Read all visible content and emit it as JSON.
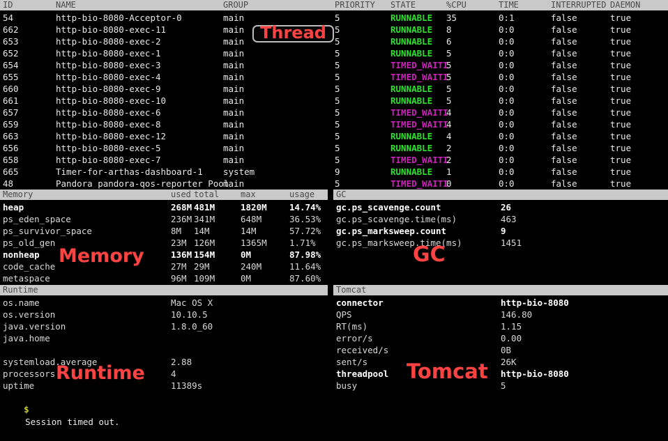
{
  "colors": {
    "background": "#000000",
    "header_bar": "#c9c9c9",
    "header_text": "#4a4a4a",
    "text": "#e8e8e8",
    "state_runnable": "#2ee22e",
    "state_timed_waiting": "#cc22bb",
    "annotation_red": "#fc4343",
    "prompt": "#c8d02a"
  },
  "thread": {
    "annotation": "Thread",
    "columns": [
      "ID",
      "NAME",
      "GROUP",
      "PRIORITY",
      "STATE",
      "%CPU",
      "TIME",
      "INTERRUPTED",
      "DAEMON"
    ],
    "rows": [
      {
        "id": "54",
        "name": "http-bio-8080-Acceptor-0",
        "group": "main",
        "priority": "5",
        "state": "RUNNABLE",
        "cpu": "35",
        "time": "0:1",
        "interrupted": "false",
        "daemon": "true"
      },
      {
        "id": "662",
        "name": "http-bio-8080-exec-11",
        "group": "main",
        "priority": "5",
        "state": "RUNNABLE",
        "cpu": "8",
        "time": "0:0",
        "interrupted": "false",
        "daemon": "true"
      },
      {
        "id": "653",
        "name": "http-bio-8080-exec-2",
        "group": "main",
        "priority": "5",
        "state": "RUNNABLE",
        "cpu": "6",
        "time": "0:0",
        "interrupted": "false",
        "daemon": "true"
      },
      {
        "id": "652",
        "name": "http-bio-8080-exec-1",
        "group": "main",
        "priority": "5",
        "state": "RUNNABLE",
        "cpu": "5",
        "time": "0:0",
        "interrupted": "false",
        "daemon": "true"
      },
      {
        "id": "654",
        "name": "http-bio-8080-exec-3",
        "group": "main",
        "priority": "5",
        "state": "TIMED_WAITI",
        "cpu": "5",
        "time": "0:0",
        "interrupted": "false",
        "daemon": "true"
      },
      {
        "id": "655",
        "name": "http-bio-8080-exec-4",
        "group": "main",
        "priority": "5",
        "state": "TIMED_WAITI",
        "cpu": "5",
        "time": "0:0",
        "interrupted": "false",
        "daemon": "true"
      },
      {
        "id": "660",
        "name": "http-bio-8080-exec-9",
        "group": "main",
        "priority": "5",
        "state": "RUNNABLE",
        "cpu": "5",
        "time": "0:0",
        "interrupted": "false",
        "daemon": "true"
      },
      {
        "id": "661",
        "name": "http-bio-8080-exec-10",
        "group": "main",
        "priority": "5",
        "state": "RUNNABLE",
        "cpu": "5",
        "time": "0:0",
        "interrupted": "false",
        "daemon": "true"
      },
      {
        "id": "657",
        "name": "http-bio-8080-exec-6",
        "group": "main",
        "priority": "5",
        "state": "TIMED_WAITI",
        "cpu": "4",
        "time": "0:0",
        "interrupted": "false",
        "daemon": "true"
      },
      {
        "id": "659",
        "name": "http-bio-8080-exec-8",
        "group": "main",
        "priority": "5",
        "state": "TIMED_WAITI",
        "cpu": "4",
        "time": "0:0",
        "interrupted": "false",
        "daemon": "true"
      },
      {
        "id": "663",
        "name": "http-bio-8080-exec-12",
        "group": "main",
        "priority": "5",
        "state": "RUNNABLE",
        "cpu": "4",
        "time": "0:0",
        "interrupted": "false",
        "daemon": "true"
      },
      {
        "id": "656",
        "name": "http-bio-8080-exec-5",
        "group": "main",
        "priority": "5",
        "state": "RUNNABLE",
        "cpu": "2",
        "time": "0:0",
        "interrupted": "false",
        "daemon": "true"
      },
      {
        "id": "658",
        "name": "http-bio-8080-exec-7",
        "group": "main",
        "priority": "5",
        "state": "TIMED_WAITI",
        "cpu": "2",
        "time": "0:0",
        "interrupted": "false",
        "daemon": "true"
      },
      {
        "id": "665",
        "name": "Timer-for-arthas-dashboard-1",
        "group": "system",
        "priority": "9",
        "state": "RUNNABLE",
        "cpu": "1",
        "time": "0:0",
        "interrupted": "false",
        "daemon": "true"
      },
      {
        "id": "48",
        "name": "Pandora pandora-qos-reporter Pool",
        "group": "main",
        "priority": "5",
        "state": "TIMED_WAITI",
        "cpu": "0",
        "time": "0:0",
        "interrupted": "false",
        "daemon": "true"
      }
    ]
  },
  "memory": {
    "annotation": "Memory",
    "columns": [
      "Memory",
      "used",
      "total",
      "max",
      "usage"
    ],
    "rows": [
      {
        "name": "heap",
        "used": "268M",
        "total": "481M",
        "max": "1820M",
        "usage": "14.74%",
        "bold": true
      },
      {
        "name": "ps_eden_space",
        "used": "236M",
        "total": "341M",
        "max": "648M",
        "usage": "36.53%",
        "bold": false
      },
      {
        "name": "ps_survivor_space",
        "used": "8M",
        "total": "14M",
        "max": "14M",
        "usage": "57.72%",
        "bold": false
      },
      {
        "name": "ps_old_gen",
        "used": "23M",
        "total": "126M",
        "max": "1365M",
        "usage": "1.71%",
        "bold": false
      },
      {
        "name": "nonheap",
        "used": "136M",
        "total": "154M",
        "max": "0M",
        "usage": "87.98%",
        "bold": true
      },
      {
        "name": "code_cache",
        "used": "27M",
        "total": "29M",
        "max": "240M",
        "usage": "11.64%",
        "bold": false
      },
      {
        "name": "metaspace",
        "used": "96M",
        "total": "109M",
        "max": "0M",
        "usage": "87.60%",
        "bold": false
      }
    ]
  },
  "gc": {
    "annotation": "GC",
    "title": "GC",
    "rows": [
      {
        "key": "gc.ps_scavenge.count",
        "value": "26",
        "bold": true
      },
      {
        "key": "gc.ps_scavenge.time(ms)",
        "value": "463",
        "bold": false
      },
      {
        "key": "gc.ps_marksweep.count",
        "value": "9",
        "bold": true
      },
      {
        "key": "gc.ps_marksweep.time(ms)",
        "value": "1451",
        "bold": false
      }
    ]
  },
  "runtime": {
    "annotation": "Runtime",
    "title": "Runtime",
    "rows": [
      {
        "key": "os.name",
        "value": "Mac OS X",
        "bold": false
      },
      {
        "key": "os.version",
        "value": "10.10.5",
        "bold": false
      },
      {
        "key": "java.version",
        "value": "1.8.0_60",
        "bold": false
      },
      {
        "key": "java.home",
        "value": "",
        "bold": false
      },
      {
        "key": "",
        "value": "",
        "bold": false
      },
      {
        "key": "systemload.average",
        "value": "2.88",
        "bold": false
      },
      {
        "key": "processors",
        "value": "4",
        "bold": false
      },
      {
        "key": "uptime",
        "value": "11389s",
        "bold": false
      }
    ]
  },
  "tomcat": {
    "annotation": "Tomcat",
    "title": "Tomcat",
    "rows": [
      {
        "key": "connector",
        "value": "http-bio-8080",
        "bold": true
      },
      {
        "key": "QPS",
        "value": "146.80",
        "bold": false
      },
      {
        "key": "RT(ms)",
        "value": "1.15",
        "bold": false
      },
      {
        "key": "error/s",
        "value": "0.00",
        "bold": false
      },
      {
        "key": "received/s",
        "value": "0B",
        "bold": false
      },
      {
        "key": "sent/s",
        "value": "26K",
        "bold": false
      },
      {
        "key": "threadpool",
        "value": "http-bio-8080",
        "bold": true
      },
      {
        "key": "busy",
        "value": "5",
        "bold": false
      }
    ]
  },
  "status": {
    "prompt": "$",
    "message": "Session timed out."
  }
}
